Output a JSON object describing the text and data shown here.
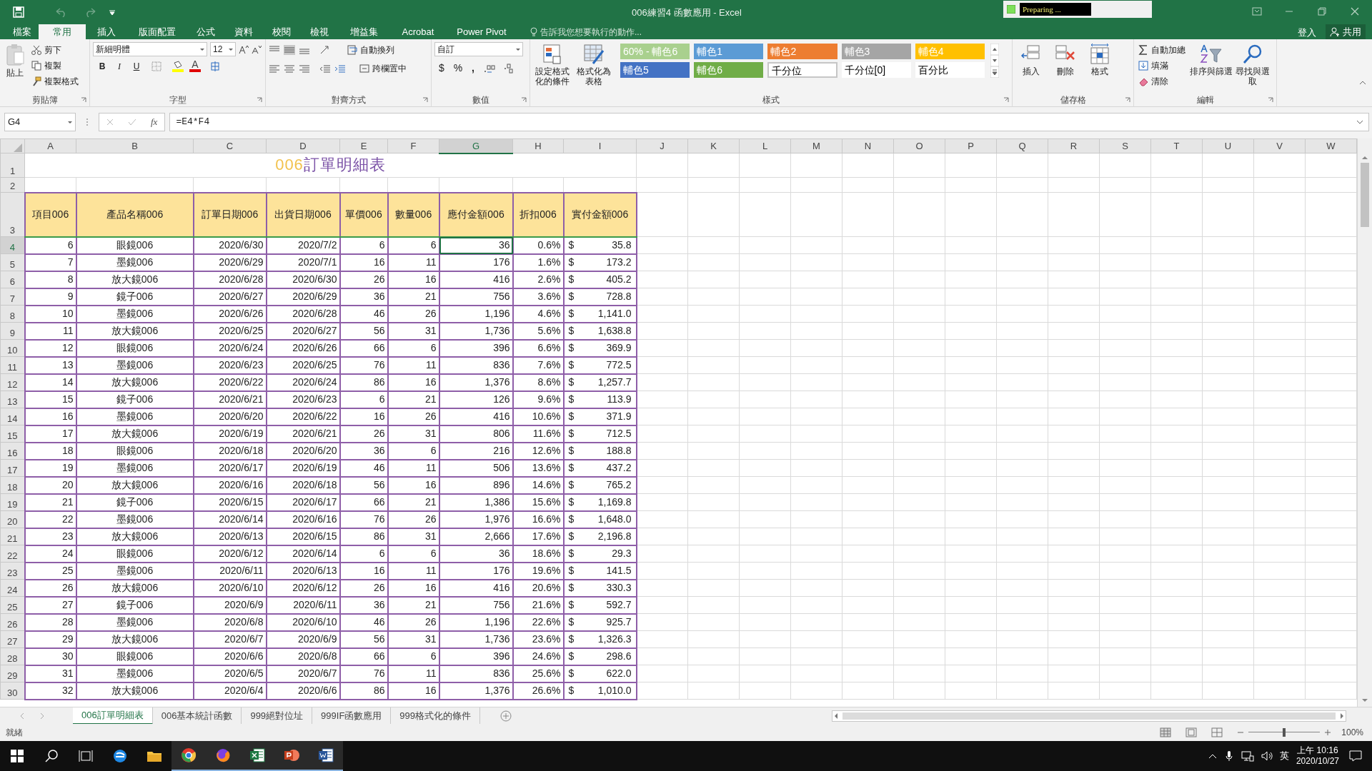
{
  "window": {
    "title": "006練習4 函數應用 - Excel",
    "recorder_status": "Preparing ...",
    "sign_in": "登入",
    "share": "共用"
  },
  "ribbon_tabs": [
    {
      "label": "檔案",
      "selected": false
    },
    {
      "label": "常用",
      "selected": true
    },
    {
      "label": "插入",
      "selected": false
    },
    {
      "label": "版面配置",
      "selected": false
    },
    {
      "label": "公式",
      "selected": false
    },
    {
      "label": "資料",
      "selected": false
    },
    {
      "label": "校閱",
      "selected": false
    },
    {
      "label": "檢視",
      "selected": false
    },
    {
      "label": "增益集",
      "selected": false
    },
    {
      "label": "Acrobat",
      "selected": false
    },
    {
      "label": "Power Pivot",
      "selected": false
    }
  ],
  "search_hint": "告訴我您想要執行的動作...",
  "clipboard": {
    "paste": "貼上",
    "cut": "剪下",
    "copy": "複製",
    "format_painter": "複製格式",
    "label": "剪貼簿"
  },
  "font": {
    "name": "新細明體",
    "size": "12",
    "bold": "B",
    "italic": "I",
    "underline": "U",
    "font_color": "A",
    "label": "字型"
  },
  "alignment": {
    "wrap": "自動換列",
    "merge": "跨欄置中",
    "label": "對齊方式"
  },
  "number": {
    "format": "自訂",
    "currency": "$",
    "percent": "%",
    "comma": ",",
    "label": "數值"
  },
  "styles": {
    "conditional": "設定格式化的條件",
    "as_table": "格式化為表格",
    "label": "樣式",
    "gallery": [
      {
        "label": "60% - 輔色6",
        "color": "#a9d08e"
      },
      {
        "label": "輔色1",
        "color": "#5b9bd5"
      },
      {
        "label": "輔色2",
        "color": "#ed7d31"
      },
      {
        "label": "輔色3",
        "color": "#a5a5a5"
      },
      {
        "label": "輔色4",
        "color": "#ffc000"
      },
      {
        "label": "輔色5",
        "color": "#4472c4"
      },
      {
        "label": "輔色6",
        "color": "#70ad47"
      },
      {
        "label": "千分位",
        "color": "#ffffff"
      },
      {
        "label": "千分位[0]",
        "color": "#ffffff"
      },
      {
        "label": "百分比",
        "color": "#ffffff"
      }
    ]
  },
  "cells_group": {
    "insert": "插入",
    "delete": "刪除",
    "format": "格式",
    "label": "儲存格"
  },
  "editing": {
    "autosum": "自動加總",
    "fill": "填滿",
    "clear": "清除",
    "sort": "排序與篩選",
    "find": "尋找與選取",
    "label": "編輯"
  },
  "formula_bar": {
    "name_box": "G4",
    "fx": "fx",
    "formula": "=E4*F4"
  },
  "columns": [
    {
      "letter": "A",
      "selected": false
    },
    {
      "letter": "B",
      "selected": false
    },
    {
      "letter": "C",
      "selected": false
    },
    {
      "letter": "D",
      "selected": false
    },
    {
      "letter": "E",
      "selected": false
    },
    {
      "letter": "F",
      "selected": false
    },
    {
      "letter": "G",
      "selected": true
    },
    {
      "letter": "H",
      "selected": false
    },
    {
      "letter": "I",
      "selected": false
    },
    {
      "letter": "J",
      "selected": false
    },
    {
      "letter": "K",
      "selected": false
    },
    {
      "letter": "L",
      "selected": false
    },
    {
      "letter": "M",
      "selected": false
    },
    {
      "letter": "N",
      "selected": false
    },
    {
      "letter": "O",
      "selected": false
    },
    {
      "letter": "P",
      "selected": false
    },
    {
      "letter": "Q",
      "selected": false
    },
    {
      "letter": "R",
      "selected": false
    },
    {
      "letter": "S",
      "selected": false
    },
    {
      "letter": "T",
      "selected": false
    },
    {
      "letter": "U",
      "selected": false
    },
    {
      "letter": "V",
      "selected": false
    },
    {
      "letter": "W",
      "selected": false
    }
  ],
  "title_row": {
    "row": "1",
    "parts": [
      {
        "text": "006",
        "color": "#f2c24e"
      },
      {
        "text": "訂單明細表",
        "color": "#7b52a6"
      }
    ]
  },
  "blank_row": {
    "row": "2"
  },
  "header_row": {
    "row": "3",
    "headers": [
      "項目006",
      "產品名稱006",
      "訂單日期006",
      "出貨日期006",
      "單價006",
      "數量006",
      "應付金額006",
      "折扣006",
      "實付金額006"
    ]
  },
  "rows": [
    {
      "row": "4",
      "selected": true,
      "cells": [
        "6",
        "眼鏡006",
        "2020/6/30",
        "2020/7/2",
        "6",
        "6",
        "36",
        "0.6%"
      ],
      "currency": "$",
      "paid": "35.8"
    },
    {
      "row": "5",
      "selected": false,
      "cells": [
        "7",
        "墨鏡006",
        "2020/6/29",
        "2020/7/1",
        "16",
        "11",
        "176",
        "1.6%"
      ],
      "currency": "$",
      "paid": "173.2"
    },
    {
      "row": "6",
      "selected": false,
      "cells": [
        "8",
        "放大鏡006",
        "2020/6/28",
        "2020/6/30",
        "26",
        "16",
        "416",
        "2.6%"
      ],
      "currency": "$",
      "paid": "405.2"
    },
    {
      "row": "7",
      "selected": false,
      "cells": [
        "9",
        "鏡子006",
        "2020/6/27",
        "2020/6/29",
        "36",
        "21",
        "756",
        "3.6%"
      ],
      "currency": "$",
      "paid": "728.8"
    },
    {
      "row": "8",
      "selected": false,
      "cells": [
        "10",
        "墨鏡006",
        "2020/6/26",
        "2020/6/28",
        "46",
        "26",
        "1,196",
        "4.6%"
      ],
      "currency": "$",
      "paid": "1,141.0"
    },
    {
      "row": "9",
      "selected": false,
      "cells": [
        "11",
        "放大鏡006",
        "2020/6/25",
        "2020/6/27",
        "56",
        "31",
        "1,736",
        "5.6%"
      ],
      "currency": "$",
      "paid": "1,638.8"
    },
    {
      "row": "10",
      "selected": false,
      "cells": [
        "12",
        "眼鏡006",
        "2020/6/24",
        "2020/6/26",
        "66",
        "6",
        "396",
        "6.6%"
      ],
      "currency": "$",
      "paid": "369.9"
    },
    {
      "row": "11",
      "selected": false,
      "cells": [
        "13",
        "墨鏡006",
        "2020/6/23",
        "2020/6/25",
        "76",
        "11",
        "836",
        "7.6%"
      ],
      "currency": "$",
      "paid": "772.5"
    },
    {
      "row": "12",
      "selected": false,
      "cells": [
        "14",
        "放大鏡006",
        "2020/6/22",
        "2020/6/24",
        "86",
        "16",
        "1,376",
        "8.6%"
      ],
      "currency": "$",
      "paid": "1,257.7"
    },
    {
      "row": "13",
      "selected": false,
      "cells": [
        "15",
        "鏡子006",
        "2020/6/21",
        "2020/6/23",
        "6",
        "21",
        "126",
        "9.6%"
      ],
      "currency": "$",
      "paid": "113.9"
    },
    {
      "row": "14",
      "selected": false,
      "cells": [
        "16",
        "墨鏡006",
        "2020/6/20",
        "2020/6/22",
        "16",
        "26",
        "416",
        "10.6%"
      ],
      "currency": "$",
      "paid": "371.9"
    },
    {
      "row": "15",
      "selected": false,
      "cells": [
        "17",
        "放大鏡006",
        "2020/6/19",
        "2020/6/21",
        "26",
        "31",
        "806",
        "11.6%"
      ],
      "currency": "$",
      "paid": "712.5"
    },
    {
      "row": "16",
      "selected": false,
      "cells": [
        "18",
        "眼鏡006",
        "2020/6/18",
        "2020/6/20",
        "36",
        "6",
        "216",
        "12.6%"
      ],
      "currency": "$",
      "paid": "188.8"
    },
    {
      "row": "17",
      "selected": false,
      "cells": [
        "19",
        "墨鏡006",
        "2020/6/17",
        "2020/6/19",
        "46",
        "11",
        "506",
        "13.6%"
      ],
      "currency": "$",
      "paid": "437.2"
    },
    {
      "row": "18",
      "selected": false,
      "cells": [
        "20",
        "放大鏡006",
        "2020/6/16",
        "2020/6/18",
        "56",
        "16",
        "896",
        "14.6%"
      ],
      "currency": "$",
      "paid": "765.2"
    },
    {
      "row": "19",
      "selected": false,
      "cells": [
        "21",
        "鏡子006",
        "2020/6/15",
        "2020/6/17",
        "66",
        "21",
        "1,386",
        "15.6%"
      ],
      "currency": "$",
      "paid": "1,169.8"
    },
    {
      "row": "20",
      "selected": false,
      "cells": [
        "22",
        "墨鏡006",
        "2020/6/14",
        "2020/6/16",
        "76",
        "26",
        "1,976",
        "16.6%"
      ],
      "currency": "$",
      "paid": "1,648.0"
    },
    {
      "row": "21",
      "selected": false,
      "cells": [
        "23",
        "放大鏡006",
        "2020/6/13",
        "2020/6/15",
        "86",
        "31",
        "2,666",
        "17.6%"
      ],
      "currency": "$",
      "paid": "2,196.8"
    },
    {
      "row": "22",
      "selected": false,
      "cells": [
        "24",
        "眼鏡006",
        "2020/6/12",
        "2020/6/14",
        "6",
        "6",
        "36",
        "18.6%"
      ],
      "currency": "$",
      "paid": "29.3"
    },
    {
      "row": "23",
      "selected": false,
      "cells": [
        "25",
        "墨鏡006",
        "2020/6/11",
        "2020/6/13",
        "16",
        "11",
        "176",
        "19.6%"
      ],
      "currency": "$",
      "paid": "141.5"
    },
    {
      "row": "24",
      "selected": false,
      "cells": [
        "26",
        "放大鏡006",
        "2020/6/10",
        "2020/6/12",
        "26",
        "16",
        "416",
        "20.6%"
      ],
      "currency": "$",
      "paid": "330.3"
    },
    {
      "row": "25",
      "selected": false,
      "cells": [
        "27",
        "鏡子006",
        "2020/6/9",
        "2020/6/11",
        "36",
        "21",
        "756",
        "21.6%"
      ],
      "currency": "$",
      "paid": "592.7"
    },
    {
      "row": "26",
      "selected": false,
      "cells": [
        "28",
        "墨鏡006",
        "2020/6/8",
        "2020/6/10",
        "46",
        "26",
        "1,196",
        "22.6%"
      ],
      "currency": "$",
      "paid": "925.7"
    },
    {
      "row": "27",
      "selected": false,
      "cells": [
        "29",
        "放大鏡006",
        "2020/6/7",
        "2020/6/9",
        "56",
        "31",
        "1,736",
        "23.6%"
      ],
      "currency": "$",
      "paid": "1,326.3"
    },
    {
      "row": "28",
      "selected": false,
      "cells": [
        "30",
        "眼鏡006",
        "2020/6/6",
        "2020/6/8",
        "66",
        "6",
        "396",
        "24.6%"
      ],
      "currency": "$",
      "paid": "298.6"
    },
    {
      "row": "29",
      "selected": false,
      "cells": [
        "31",
        "墨鏡006",
        "2020/6/5",
        "2020/6/7",
        "76",
        "11",
        "836",
        "25.6%"
      ],
      "currency": "$",
      "paid": "622.0"
    },
    {
      "row": "30",
      "selected": false,
      "cells": [
        "32",
        "放大鏡006",
        "2020/6/4",
        "2020/6/6",
        "86",
        "16",
        "1,376",
        "26.6%"
      ],
      "currency": "$",
      "paid": "1,010.0"
    }
  ],
  "sheet_tabs": [
    {
      "label": "006訂單明細表",
      "selected": true
    },
    {
      "label": "006基本統計函數",
      "selected": false
    },
    {
      "label": "999絕對位址",
      "selected": false
    },
    {
      "label": "999IF函數應用",
      "selected": false
    },
    {
      "label": "999格式化的條件",
      "selected": false
    }
  ],
  "status_bar": {
    "status": "就緒",
    "zoom_slider": {
      "level": 0.5
    },
    "zoom": "100%"
  },
  "taskbar": {
    "ime": "英",
    "time": "上午 10:16",
    "date": "2020/10/27"
  }
}
